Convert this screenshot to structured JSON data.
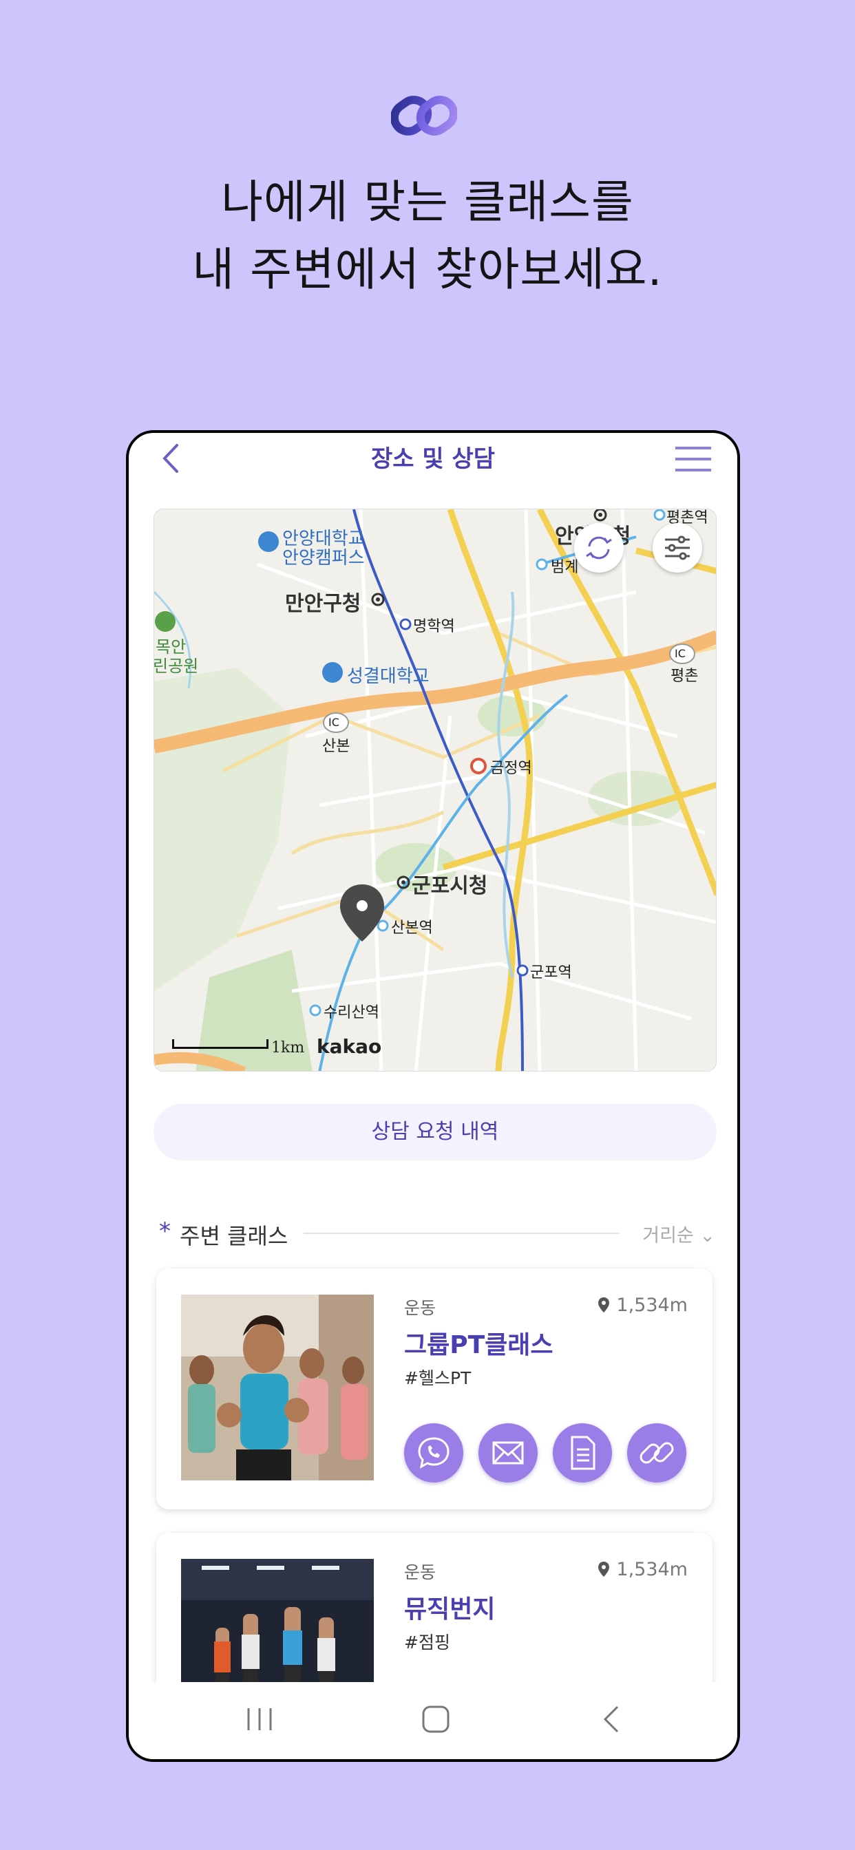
{
  "hero": {
    "line1": "나에게 맞는 클래스를",
    "line2": "내 주변에서 찾아보세요.",
    "logo_icon": "chain-link-logo-icon"
  },
  "app": {
    "title": "장소 및 상담",
    "back_icon": "chevron-left-icon",
    "menu_icon": "hamburger-menu-icon",
    "accent_color": "#4a3fb0"
  },
  "map": {
    "labels": {
      "anyang_univ_1": "안양대학교",
      "anyang_univ_2": "안양캠퍼스",
      "anyang_city": "안양시청",
      "pyeongchon_st": "평촌역",
      "beomgye_st": "범계",
      "manan_office": "만안구청",
      "myeonghak_st": "명학역",
      "mokan_1": "목안",
      "mokan_2": "린공원",
      "sunggyul_univ": "성결대학교",
      "pyeongchon_ic": "평촌",
      "sanbon_ic": "산본",
      "geumjeong_st": "금정역",
      "gunpo_city": "군포시청",
      "sanbon_st": "산본역",
      "gunpo_st": "군포역",
      "surisan_st": "수리산역",
      "ic": "IC"
    },
    "scale": "1km",
    "brand": "kakao",
    "refresh_icon": "refresh-icon",
    "filter_icon": "sliders-icon"
  },
  "consult_button": "상담 요청 내역",
  "section": {
    "star": "*",
    "title": "주변 클래스",
    "sort": "거리순 ⌄"
  },
  "classes": [
    {
      "category": "운동",
      "distance": "1,534m",
      "name": "그룹PT클래스",
      "tag": "#헬스PT"
    },
    {
      "category": "운동",
      "distance": "1,534m",
      "name": "뮤직번지",
      "tag": "#점핑"
    }
  ],
  "actions": [
    "phone-icon",
    "mail-icon",
    "document-icon",
    "link-icon"
  ],
  "navbar": [
    "recent-apps-icon",
    "home-icon",
    "back-icon"
  ]
}
